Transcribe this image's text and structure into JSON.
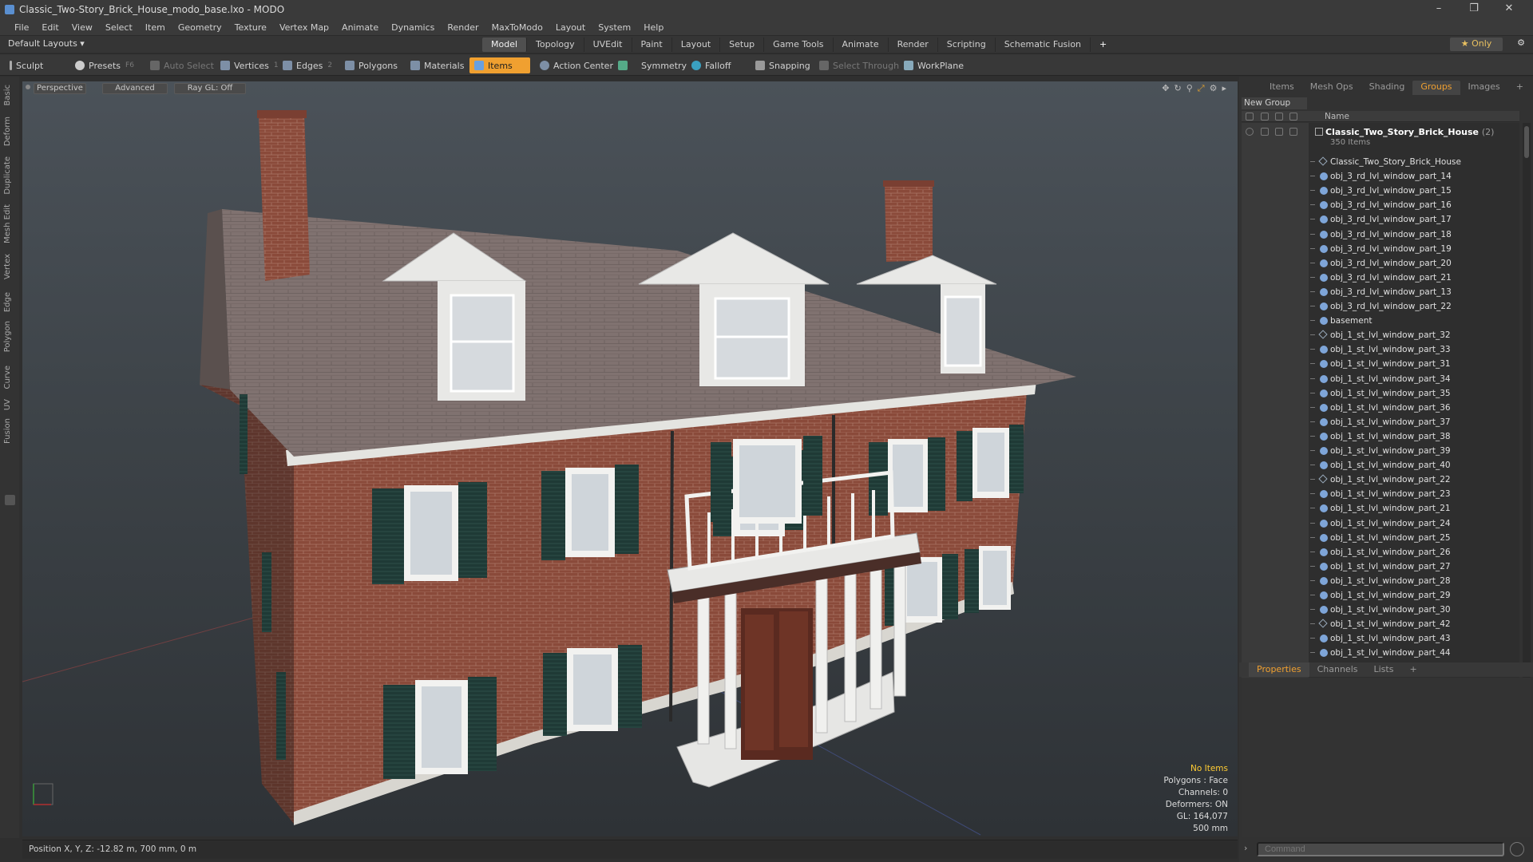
{
  "window": {
    "title": "Classic_Two-Story_Brick_House_modo_base.lxo - MODO",
    "controls": [
      "–",
      "❐",
      "✕"
    ]
  },
  "menu": [
    "File",
    "Edit",
    "View",
    "Select",
    "Item",
    "Geometry",
    "Texture",
    "Vertex Map",
    "Animate",
    "Dynamics",
    "Render",
    "MaxToModo",
    "Layout",
    "System",
    "Help"
  ],
  "layout": {
    "label": "Default Layouts ▾",
    "tabs": [
      "Model",
      "Topology",
      "UVEdit",
      "Paint",
      "Layout",
      "Setup",
      "Game Tools",
      "Animate",
      "Render",
      "Scripting",
      "Schematic Fusion"
    ],
    "active_tab": "Model",
    "only": "★  Only"
  },
  "toolbar": {
    "sculpt": "Sculpt",
    "presets": "Presets",
    "presets_key": "F6",
    "auto_select": "Auto Select",
    "vertices": "Vertices",
    "vertices_count": "1",
    "edges": "Edges",
    "edges_count": "2",
    "polygons": "Polygons",
    "materials": "Materials",
    "items": "Items",
    "action_center": "Action Center",
    "symmetry": "Symmetry",
    "falloff": "Falloff",
    "snapping": "Snapping",
    "select_through": "Select Through",
    "workplane": "WorkPlane"
  },
  "left_tabs": [
    "Basic",
    "Deform",
    "Duplicate",
    "Mesh Edit",
    "Vertex",
    "Edge",
    "Polygon",
    "Curve",
    "UV",
    "Fusion"
  ],
  "viewport": {
    "perspective": "Perspective",
    "advanced": "Advanced",
    "raygl": "Ray GL: Off",
    "info": {
      "no_items": "No Items",
      "polygons": "Polygons : Face",
      "channels": "Channels: 0",
      "deformers": "Deformers: ON",
      "gl": "GL: 164,077",
      "scale": "500 mm"
    }
  },
  "status": {
    "position": "Position X, Y, Z:   -12.82 m, 700 mm, 0 m"
  },
  "right_panel": {
    "tabs": [
      "Items",
      "Mesh Ops",
      "Shading",
      "Groups",
      "Images",
      "+"
    ],
    "active_tab": "Groups",
    "new_group": "New Group",
    "name_header": "Name",
    "group": {
      "name": "Classic_Two_Story_Brick_House",
      "count": "(2)",
      "sub": "350 Items"
    },
    "items": [
      {
        "name": "Classic_Two_Story_Brick_House",
        "type": "loc"
      },
      {
        "name": "obj_3_rd_lvl_window_part_14",
        "type": "mesh"
      },
      {
        "name": "obj_3_rd_lvl_window_part_15",
        "type": "mesh"
      },
      {
        "name": "obj_3_rd_lvl_window_part_16",
        "type": "mesh"
      },
      {
        "name": "obj_3_rd_lvl_window_part_17",
        "type": "mesh"
      },
      {
        "name": "obj_3_rd_lvl_window_part_18",
        "type": "mesh"
      },
      {
        "name": "obj_3_rd_lvl_window_part_19",
        "type": "mesh"
      },
      {
        "name": "obj_3_rd_lvl_window_part_20",
        "type": "mesh"
      },
      {
        "name": "obj_3_rd_lvl_window_part_21",
        "type": "mesh"
      },
      {
        "name": "obj_3_rd_lvl_window_part_13",
        "type": "mesh"
      },
      {
        "name": "obj_3_rd_lvl_window_part_22",
        "type": "mesh"
      },
      {
        "name": "basement",
        "type": "mesh"
      },
      {
        "name": "obj_1_st_lvl_window_part_32",
        "type": "loc"
      },
      {
        "name": "obj_1_st_lvl_window_part_33",
        "type": "mesh"
      },
      {
        "name": "obj_1_st_lvl_window_part_31",
        "type": "mesh"
      },
      {
        "name": "obj_1_st_lvl_window_part_34",
        "type": "mesh"
      },
      {
        "name": "obj_1_st_lvl_window_part_35",
        "type": "mesh"
      },
      {
        "name": "obj_1_st_lvl_window_part_36",
        "type": "mesh"
      },
      {
        "name": "obj_1_st_lvl_window_part_37",
        "type": "mesh"
      },
      {
        "name": "obj_1_st_lvl_window_part_38",
        "type": "mesh"
      },
      {
        "name": "obj_1_st_lvl_window_part_39",
        "type": "mesh"
      },
      {
        "name": "obj_1_st_lvl_window_part_40",
        "type": "mesh"
      },
      {
        "name": "obj_1_st_lvl_window_part_22",
        "type": "loc"
      },
      {
        "name": "obj_1_st_lvl_window_part_23",
        "type": "mesh"
      },
      {
        "name": "obj_1_st_lvl_window_part_21",
        "type": "mesh"
      },
      {
        "name": "obj_1_st_lvl_window_part_24",
        "type": "mesh"
      },
      {
        "name": "obj_1_st_lvl_window_part_25",
        "type": "mesh"
      },
      {
        "name": "obj_1_st_lvl_window_part_26",
        "type": "mesh"
      },
      {
        "name": "obj_1_st_lvl_window_part_27",
        "type": "mesh"
      },
      {
        "name": "obj_1_st_lvl_window_part_28",
        "type": "mesh"
      },
      {
        "name": "obj_1_st_lvl_window_part_29",
        "type": "mesh"
      },
      {
        "name": "obj_1_st_lvl_window_part_30",
        "type": "mesh"
      },
      {
        "name": "obj_1_st_lvl_window_part_42",
        "type": "loc"
      },
      {
        "name": "obj_1_st_lvl_window_part_43",
        "type": "mesh"
      },
      {
        "name": "obj_1_st_lvl_window_part_44",
        "type": "mesh"
      }
    ],
    "prop_tabs": [
      "Properties",
      "Channels",
      "Lists",
      "+"
    ],
    "prop_active": "Properties",
    "command_placeholder": "Command"
  },
  "colors": {
    "accent": "#f0a030",
    "brick": "#8a4a3a",
    "roof": "#7a6e6a",
    "shutter": "#1f3a36",
    "trim": "#e4e4e0"
  }
}
